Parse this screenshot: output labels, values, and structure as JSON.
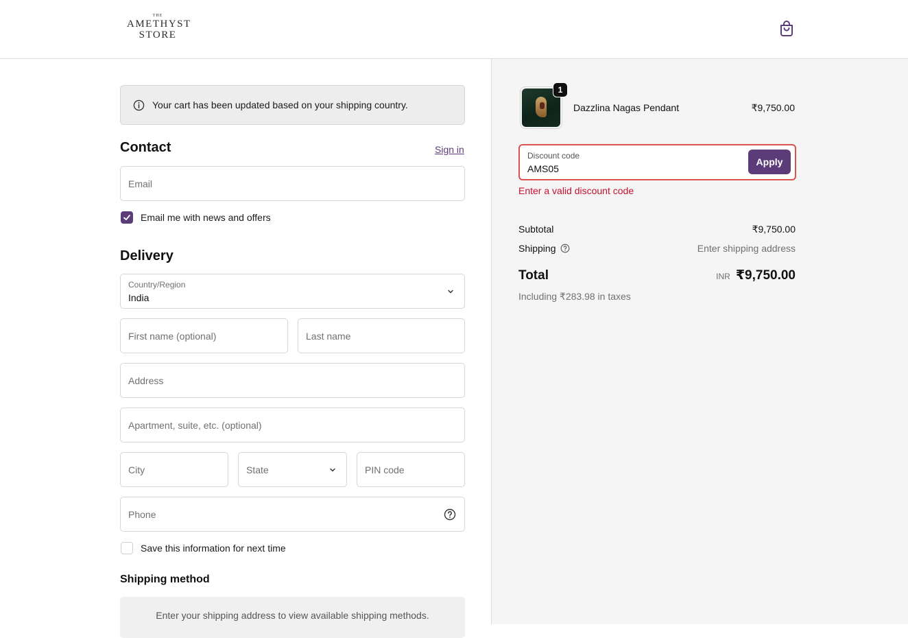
{
  "header": {
    "logo_the": "THE",
    "logo_line1": "AMETHYST",
    "logo_line2": "STORE",
    "cart_icon": "shopping-bag-icon"
  },
  "notice": {
    "icon": "info-circle-icon",
    "text": "Your cart has been updated based on your shipping country."
  },
  "contact": {
    "heading": "Contact",
    "sign_in": "Sign in",
    "email_placeholder": "Email",
    "news_checkbox_label": "Email me with news and offers",
    "news_checked": true
  },
  "delivery": {
    "heading": "Delivery",
    "country_label": "Country/Region",
    "country_value": "India",
    "first_name_placeholder": "First name (optional)",
    "last_name_placeholder": "Last name",
    "address_placeholder": "Address",
    "apartment_placeholder": "Apartment, suite, etc. (optional)",
    "city_placeholder": "City",
    "state_placeholder": "State",
    "pin_placeholder": "PIN code",
    "phone_placeholder": "Phone",
    "save_info_label": "Save this information for next time",
    "save_info_checked": false
  },
  "shipping_method": {
    "heading": "Shipping method",
    "message": "Enter your shipping address to view available shipping methods."
  },
  "summary": {
    "item": {
      "quantity": "1",
      "name": "Dazzlina Nagas Pendant",
      "price": "₹9,750.00"
    },
    "discount": {
      "label": "Discount code",
      "value": "AMS05",
      "apply_label": "Apply",
      "error": "Enter a valid discount code"
    },
    "subtotal_label": "Subtotal",
    "subtotal_value": "₹9,750.00",
    "shipping_label": "Shipping",
    "shipping_value": "Enter shipping address",
    "total_label": "Total",
    "total_currency": "INR",
    "total_value": "₹9,750.00",
    "taxes_note": "Including ₹283.98 in taxes"
  },
  "colors": {
    "accent": "#5c3b79",
    "error": "#c8102e",
    "error_border": "#d9534f"
  }
}
